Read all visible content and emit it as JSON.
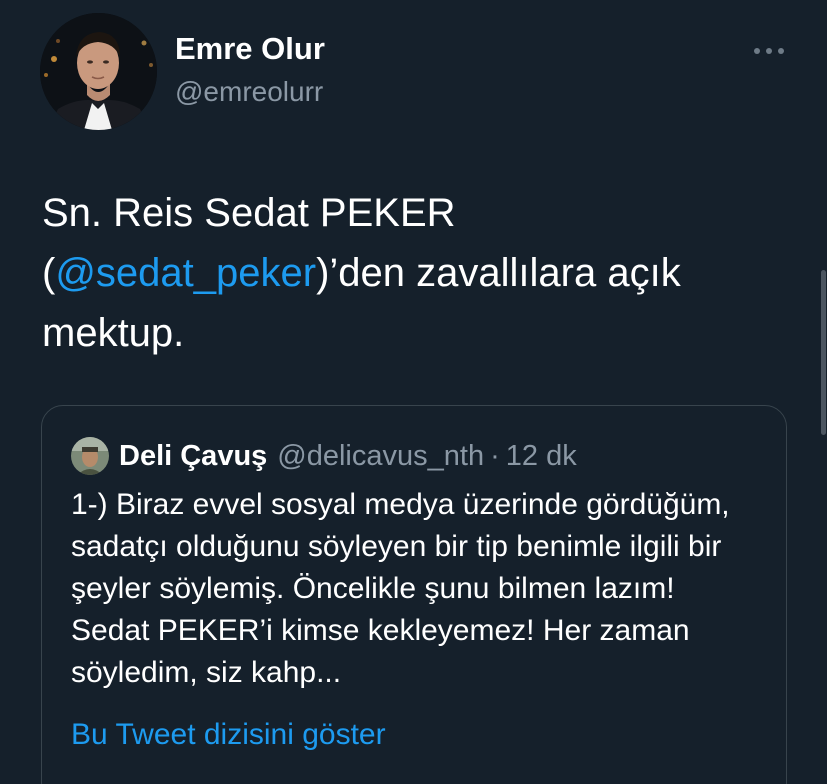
{
  "author": {
    "name": "Emre Olur",
    "handle": "@emreolurr"
  },
  "tweet": {
    "text_before": "Sn. Reis Sedat PEKER (",
    "mention": "@sedat_peker",
    "text_after": ")’den zavallılara açık mektup."
  },
  "quoted_tweet": {
    "name": "Deli Çavuş",
    "handle": "@delicavus_nth",
    "separator": "·",
    "time": "12 dk",
    "text": "1-) Biraz evvel sosyal medya üzerinde gördüğüm, sadatçı olduğunu söyleyen bir tip benimle ilgili bir şeyler söylemiş. Öncelikle şunu bilmen lazım! Sedat PEKER’i kimse kekleyemez! Her zaman söyledim, siz kahp...",
    "show_thread_label": "Bu Tweet dizisini göster"
  },
  "icons": {
    "more": "more-horizontal-icon"
  },
  "colors": {
    "background": "#15202b",
    "accent": "#1d9bf0",
    "secondary_text": "#8b98a5",
    "border": "#38444d"
  }
}
